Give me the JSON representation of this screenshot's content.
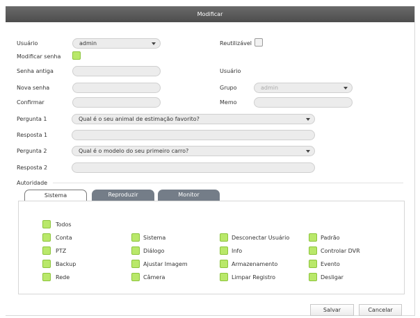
{
  "dialog": {
    "title": "Modificar"
  },
  "form": {
    "usuario_label": "Usuário",
    "usuario_value": "admin",
    "reutilizavel_label": "Reutilizável",
    "modificar_senha_label": "Modificar senha",
    "senha_antiga_label": "Senha antiga",
    "usuario_right_label": "Usuário",
    "nova_senha_label": "Nova senha",
    "grupo_label": "Grupo",
    "grupo_value": "admin",
    "confirmar_label": "Confirmar",
    "memo_label": "Memo",
    "pergunta1_label": "Pergunta 1",
    "pergunta1_value": "Qual é o seu animal de estimação favorito?",
    "resposta1_label": "Resposta 1",
    "pergunta2_label": "Pergunta 2",
    "pergunta2_value": "Qual é o modelo do seu primeiro carro?",
    "resposta2_label": "Resposta 2",
    "autoridade_label": "Autoridade"
  },
  "tabs": [
    "Sistema",
    "Reproduzir",
    "Monitor"
  ],
  "permissions": {
    "todos": "Todos",
    "col1": [
      "Conta",
      "PTZ",
      "Backup",
      "Rede"
    ],
    "col2": [
      "Sistema",
      "Diálogo",
      "Ajustar Imagem",
      "Câmera"
    ],
    "col3": [
      "Desconectar Usuário",
      "Info",
      "Armazenamento",
      "Limpar Registro"
    ],
    "col4": [
      "Padrão",
      "Controlar DVR",
      "Evento",
      "Desligar"
    ]
  },
  "buttons": {
    "save": "Salvar",
    "cancel": "Cancelar"
  },
  "colors": {
    "titlebar": "#555555",
    "checkbox_checked": "#b9e86a",
    "tab_inactive": "#747d88"
  }
}
